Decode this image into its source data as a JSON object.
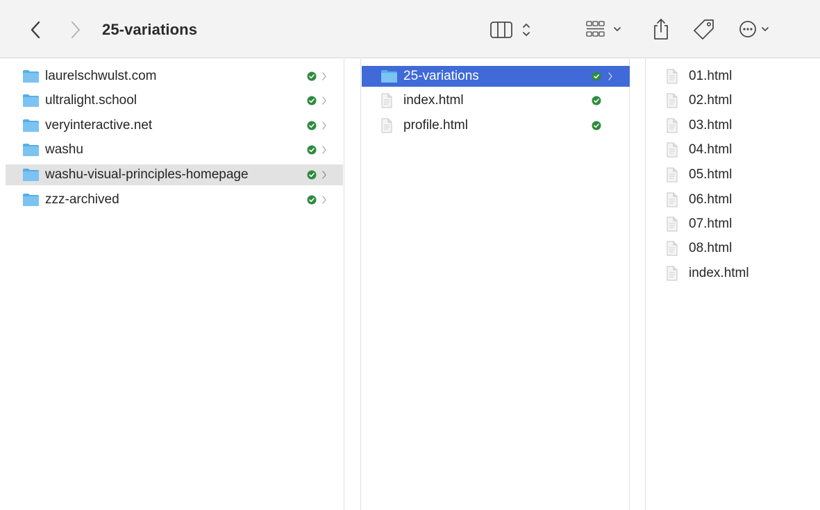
{
  "toolbar": {
    "title": "25-variations",
    "back_icon": "chevron-left-icon",
    "forward_icon": "chevron-right-icon",
    "view_icon": "column-view-icon",
    "group_icon": "group-grid-icon",
    "share_icon": "share-icon",
    "tag_icon": "tag-icon",
    "more_icon": "ellipsis-circle-icon"
  },
  "columns": {
    "col1": {
      "items": [
        {
          "label": "laurelschwulst.com",
          "type": "folder",
          "status": "synced"
        },
        {
          "label": "ultralight.school",
          "type": "folder",
          "status": "synced"
        },
        {
          "label": "veryinteractive.net",
          "type": "folder",
          "status": "synced"
        },
        {
          "label": "washu",
          "type": "folder",
          "status": "synced"
        },
        {
          "label": "washu-visual-principles-homepage",
          "type": "folder",
          "status": "synced",
          "state": "highlighted"
        },
        {
          "label": "zzz-archived",
          "type": "folder",
          "status": "synced"
        }
      ]
    },
    "col2": {
      "items": [
        {
          "label": "25-variations",
          "type": "folder",
          "status": "synced",
          "state": "selected"
        },
        {
          "label": "index.html",
          "type": "file",
          "status": "synced"
        },
        {
          "label": "profile.html",
          "type": "file",
          "status": "synced"
        }
      ]
    },
    "col3": {
      "items": [
        {
          "label": "01.html",
          "type": "file"
        },
        {
          "label": "02.html",
          "type": "file"
        },
        {
          "label": "03.html",
          "type": "file"
        },
        {
          "label": "04.html",
          "type": "file"
        },
        {
          "label": "05.html",
          "type": "file"
        },
        {
          "label": "06.html",
          "type": "file"
        },
        {
          "label": "07.html",
          "type": "file"
        },
        {
          "label": "08.html",
          "type": "file"
        },
        {
          "label": "index.html",
          "type": "file"
        }
      ]
    }
  },
  "colors": {
    "selection": "#3f6ad8",
    "highlight": "#e2e2e2",
    "sync_green": "#2e8b3e",
    "folder_blue": "#5ab0ea",
    "toolbar_bg": "#f3f3f3"
  }
}
